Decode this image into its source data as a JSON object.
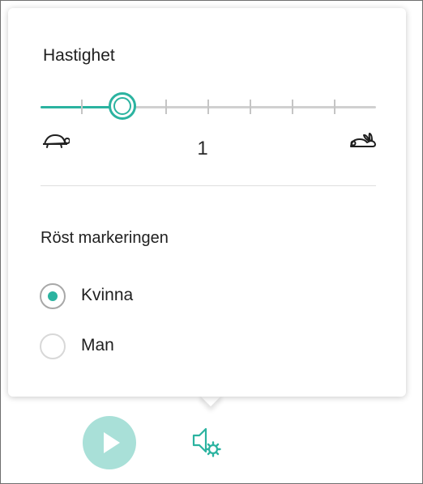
{
  "speed": {
    "title": "Hastighet",
    "value": "1",
    "slider_fraction": 0.25,
    "slow_icon": "turtle-icon",
    "fast_icon": "rabbit-icon"
  },
  "voice": {
    "title": "Röst markeringen",
    "options": [
      {
        "label": "Kvinna",
        "selected": true
      },
      {
        "label": "Man",
        "selected": false
      }
    ]
  },
  "controls": {
    "play_icon": "play-icon",
    "voice_settings_icon": "voice-settings-icon"
  },
  "colors": {
    "accent": "#2bb3a0",
    "play_button": "#a9e0d8",
    "track": "#d0d0d0"
  }
}
